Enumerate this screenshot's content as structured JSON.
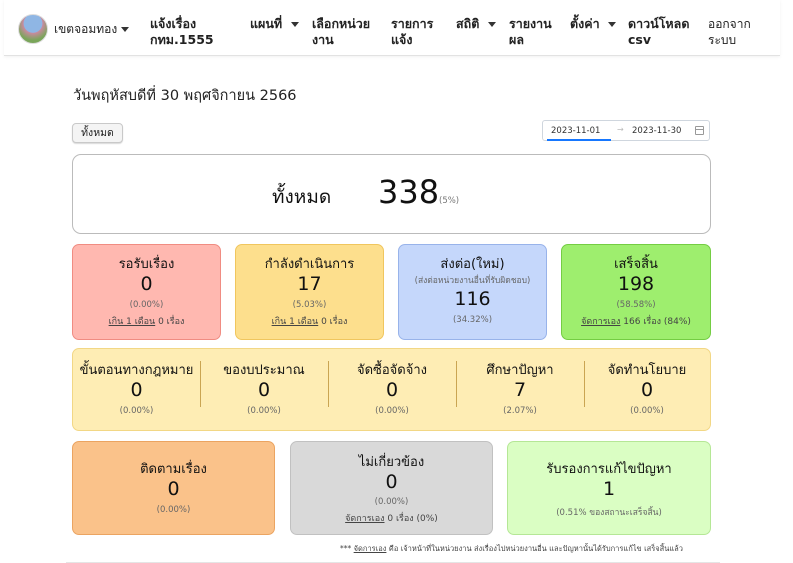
{
  "navbar": {
    "district": "เขตจอมทอง",
    "report_issue": "แจ้งเรื่อง กทม.1555",
    "map": "แผนที่",
    "select_unit": "เลือกหน่วยงาน",
    "reports": "รายการแจ้ง",
    "stats": "สถิติ",
    "results": "รายงานผล",
    "settings": "ตั้งค่า",
    "download": "ดาวน์โหลด csv",
    "logout": "ออกจากระบบ"
  },
  "page": {
    "date_heading": "วันพฤหัสบดีที่ 30 พฤศจิกายน 2566",
    "all_button": "ทั้งหมด",
    "date_from": "2023-11-01",
    "date_to": "2023-11-30",
    "date_separator": "→"
  },
  "total": {
    "label": "ทั้งหมด",
    "value": "338",
    "pct": "(5%)"
  },
  "status_cards": {
    "pending": {
      "title": "รอรับเรื่อง",
      "value": "0",
      "pct": "(0.00%)",
      "note_link": "เกิน 1 เดือน",
      "note_rest": " 0 เรื่อง"
    },
    "in_progress": {
      "title": "กำลังดำเนินการ",
      "value": "17",
      "pct": "(5.03%)",
      "note_link": "เกิน 1 เดือน",
      "note_rest": " 0 เรื่อง"
    },
    "forwarded": {
      "title": "ส่งต่อ(ใหม่)",
      "subtitle": "(ส่งต่อหน่วยงานอื่นที่รับผิดชอบ)",
      "value": "116",
      "pct": "(34.32%)"
    },
    "done": {
      "title": "เสร็จสิ้น",
      "value": "198",
      "pct": "(58.58%)",
      "note_link": "จัดการเอง",
      "note_rest": " 166 เรื่อง (84%)"
    }
  },
  "sub_stats": [
    {
      "title": "ขั้นตอนทางกฎหมาย",
      "value": "0",
      "pct": "(0.00%)"
    },
    {
      "title": "ของบประมาณ",
      "value": "0",
      "pct": "(0.00%)"
    },
    {
      "title": "จัดซื้อจัดจ้าง",
      "value": "0",
      "pct": "(0.00%)"
    },
    {
      "title": "ศึกษาปัญหา",
      "value": "7",
      "pct": "(2.07%)"
    },
    {
      "title": "จัดทำนโยบาย",
      "value": "0",
      "pct": "(0.00%)"
    }
  ],
  "bottom_cards": {
    "follow_up": {
      "title": "ติดตามเรื่อง",
      "value": "0",
      "pct": "(0.00%)"
    },
    "unrelated": {
      "title": "ไม่เกี่ยวข้อง",
      "value": "0",
      "pct": "(0.00%)",
      "note_link": "จัดการเอง",
      "note_rest": " 0 เรื่อง (0%)"
    },
    "certified": {
      "title": "รับรองการแก้ไขปัญหา",
      "value": "1",
      "pct": "(0.51% ของสถานะเสร็จสิ้น)"
    }
  },
  "footnote": {
    "prefix": "*** ",
    "link": "จัดการเอง",
    "text": " คือ เจ้าหน้าที่ในหน่วยงาน ส่งเรื่องไปหน่วยงานอื่น และปัญหานั้นได้รับการแก้ไข เสร็จสิ้นแล้ว"
  },
  "colors": {
    "pending": "#ffb8b0",
    "in_progress": "#fddf8d",
    "forwarded": "#c5d7fb",
    "done": "#9eee6e",
    "sub_stats": "#feedb4",
    "follow_up": "#fac28a",
    "unrelated": "#d9d9d9",
    "certified": "#dafec3"
  },
  "icons": {
    "district_caret": "chevron-down-icon",
    "calendar": "calendar-icon"
  }
}
